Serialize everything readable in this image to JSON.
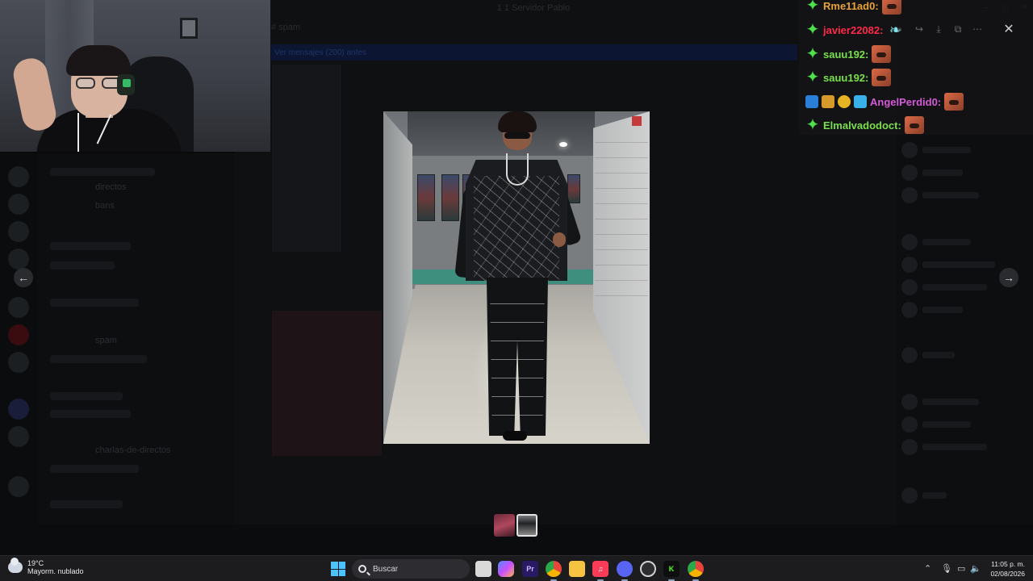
{
  "window": {
    "title": "1 1 Servidor Pablo"
  },
  "channel_header": {
    "name": "# spam",
    "banner": "Ver mensajes (200) antes"
  },
  "background_channels": [
    "directos",
    "bans",
    "spam",
    "charlas-de-directos"
  ],
  "chat_overlay": {
    "messages": [
      {
        "user": "Rme11ad0:",
        "color": "#e8a23b",
        "badges": [
          "star"
        ],
        "content": "emote"
      },
      {
        "user": "javier22082:",
        "color": "#ff2a4a",
        "badges": [
          "star"
        ],
        "content": "feather-emote"
      },
      {
        "user": "sauu192:",
        "color": "#79e04d",
        "badges": [
          "star"
        ],
        "content": "emote"
      },
      {
        "user": "sauu192:",
        "color": "#79e04d",
        "badges": [
          "star"
        ],
        "content": "emote"
      },
      {
        "user": "AngelPerdid0:",
        "color": "#d45ad8",
        "badges": [
          "hammer",
          "crown",
          "gift-1",
          "cube"
        ],
        "content": "emote"
      },
      {
        "user": "Elmalvadodoct:",
        "color": "#79e04d",
        "badges": [
          "star"
        ],
        "content": "emote"
      }
    ]
  },
  "viewer": {
    "image_alt": "man walking in arena tunnel",
    "prev_icon": "arrow-left-icon",
    "next_icon": "arrow-right-icon",
    "close_icon": "close-icon",
    "tools": [
      "zoom-icon",
      "forward-icon",
      "download-icon",
      "open-external-icon",
      "more-icon"
    ]
  },
  "taskbar": {
    "weather": {
      "temp": "19°C",
      "desc": "Mayorm. nublado"
    },
    "search_placeholder": "Buscar",
    "apps": [
      {
        "name": "task-view-icon",
        "label": "",
        "color": "#d9d9d9"
      },
      {
        "name": "copilot-icon",
        "label": "",
        "color": "#4f8cff"
      },
      {
        "name": "premiere-icon",
        "label": "Pr",
        "color": "#2a1a66"
      },
      {
        "name": "chrome-icon",
        "label": "",
        "color": "#e8453c"
      },
      {
        "name": "file-explorer-icon",
        "label": "",
        "color": "#f5c242"
      },
      {
        "name": "music-icon",
        "label": "",
        "color": "#fa3c59"
      },
      {
        "name": "discord-icon",
        "label": "",
        "color": "#5865f2"
      },
      {
        "name": "obs-icon",
        "label": "",
        "color": "#2e2e32"
      },
      {
        "name": "kick-icon",
        "label": "K",
        "color": "#53fc18"
      },
      {
        "name": "chrome-profile-icon",
        "label": "",
        "color": "#e8453c"
      }
    ],
    "time": "11:05 p. m.",
    "date": "02/08/2026"
  }
}
